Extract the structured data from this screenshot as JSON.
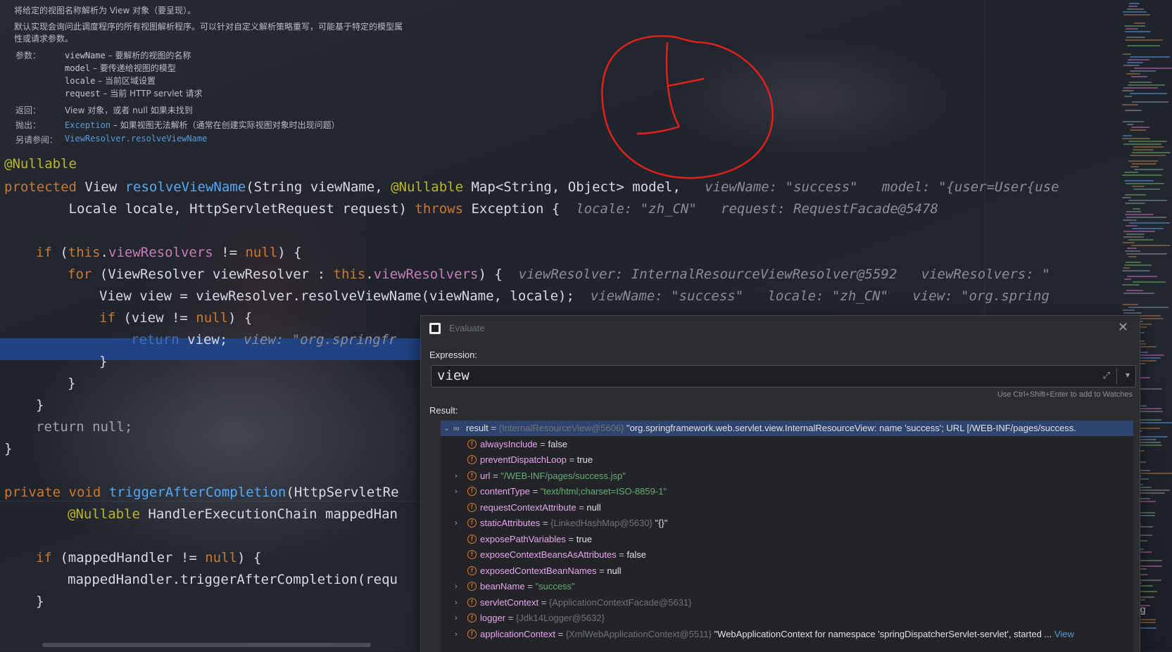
{
  "doc": {
    "line1": "将给定的视图名称解析为 View 对象（要呈现）。",
    "line2": "默认实现会询问此调度程序的所有视图解析程序。可以针对自定义解析策略重写，可能基于特定的模型属",
    "line3": "性或请求参数。",
    "params_label": "参数：",
    "params": [
      {
        "name": "viewName",
        "desc": " – 要解析的视图的名称"
      },
      {
        "name": "model",
        "desc": " – 要传递给视图的模型"
      },
      {
        "name": "locale",
        "desc": " – 当前区域设置"
      },
      {
        "name": "request",
        "desc": " – 当前 HTTP servlet 请求"
      }
    ],
    "returns_label": "返回：",
    "returns": "View 对象，或者 null 如果未找到",
    "throws_label": "抛出：",
    "throws_name": "Exception",
    "throws_desc": " – 如果视图无法解析（通常在创建实际视图对象时出现问题）",
    "see_label": "另请参阅：",
    "see_link": "ViewResolver.resolveViewName"
  },
  "code": {
    "l1": {
      "t": "@Nullable"
    },
    "l2": {
      "a": "protected",
      "b": " View ",
      "c": "resolveViewName",
      "d": "(String viewName, ",
      "e": "@Nullable",
      "f": " Map<String, Object> model,",
      "h1": "viewName: \"success\"",
      "h2": "model: \"{user=User{use"
    },
    "l3": {
      "a": "        Locale locale, HttpServletRequest request) ",
      "b": "throws",
      "c": " Exception {",
      "h1": "locale: \"zh_CN\"",
      "h2": "request: RequestFacade@5478"
    },
    "l4": {
      "a": "if",
      "b": " (",
      "c": "this",
      "d": ".",
      "e": "viewResolvers",
      "f": " != ",
      "g": "null",
      "h": ") {"
    },
    "l5": {
      "a": "for",
      "b": " (ViewResolver viewResolver : ",
      "c": "this",
      "d": ".",
      "e": "viewResolvers",
      "f": ") {",
      "h1": "viewResolver: InternalResourceViewResolver@5592",
      "h2": "viewResolvers: \""
    },
    "l6": {
      "a": "View view = viewResolver.resolveViewName(viewName, locale);",
      "h1": "viewName: \"success\"",
      "h2": "locale: \"zh_CN\"",
      "h3": "view: \"org.spring"
    },
    "l7": {
      "a": "if",
      "b": " (view != ",
      "c": "null",
      "d": ") {"
    },
    "l8": {
      "a": "return",
      "b": " view;",
      "h1": "view: \"org.springfr"
    },
    "l9": {
      "a": "}"
    },
    "l10": {
      "a": "}"
    },
    "l11": {
      "a": "}"
    },
    "l12": {
      "a": "return null;"
    },
    "l13": {
      "a": "}"
    },
    "l14": {
      "a": "private",
      "b": " void ",
      "c": "triggerAfterCompletion",
      "d": "(HttpServletRe"
    },
    "l15": {
      "a": "@Nullable",
      "b": " HandlerExecutionChain mappedHan"
    },
    "l16": {
      "a": "if",
      "b": " (mappedHandler != ",
      "c": "null",
      "d": ") {"
    },
    "l17": {
      "a": "mappedHandler.triggerAfterCompletion(requ"
    },
    "l18": {
      "a": "}"
    }
  },
  "dialog": {
    "title": "Evaluate",
    "expression_label": "Expression:",
    "expression_value": "view",
    "watches_hint": "Use Ctrl+Shift+Enter to add to Watches",
    "result_label": "Result:",
    "result": {
      "name": "result",
      "ref": "{InternalResourceView@5606}",
      "value": "\"org.springframework.web.servlet.view.InternalResourceView: name 'success'; URL [/WEB-INF/pages/success."
    },
    "fields": [
      {
        "name": "alwaysInclude",
        "value": "false",
        "expandable": false
      },
      {
        "name": "preventDispatchLoop",
        "value": "true",
        "expandable": false
      },
      {
        "name": "url",
        "value": "\"/WEB-INF/pages/success.jsp\"",
        "expandable": true,
        "kind": "str"
      },
      {
        "name": "contentType",
        "value": "\"text/html;charset=ISO-8859-1\"",
        "expandable": true,
        "kind": "str"
      },
      {
        "name": "requestContextAttribute",
        "value": "null",
        "expandable": false
      },
      {
        "name": "staticAttributes",
        "ref": "{LinkedHashMap@5630}",
        "value": "\"{}\"",
        "expandable": true
      },
      {
        "name": "exposePathVariables",
        "value": "true",
        "expandable": false
      },
      {
        "name": "exposeContextBeansAsAttributes",
        "value": "false",
        "expandable": false
      },
      {
        "name": "exposedContextBeanNames",
        "value": "null",
        "expandable": false
      },
      {
        "name": "beanName",
        "value": "\"success\"",
        "expandable": true,
        "kind": "str"
      },
      {
        "name": "servletContext",
        "ref": "{ApplicationContextFacade@5631}",
        "value": "",
        "expandable": true
      },
      {
        "name": "logger",
        "ref": "{Jdk14Logger@5632}",
        "value": "",
        "expandable": true
      },
      {
        "name": "applicationContext",
        "ref": "{XmlWebApplicationContext@5511}",
        "value": "\"WebApplicationContext for namespace 'springDispatcherServlet-servlet', started ...",
        "expandable": true,
        "link": "View"
      }
    ]
  },
  "side_text": "ng",
  "colors": {
    "annotation_red": "#e0201a",
    "breakpoint_line": "#214283",
    "accent": "#5b9ad6"
  }
}
